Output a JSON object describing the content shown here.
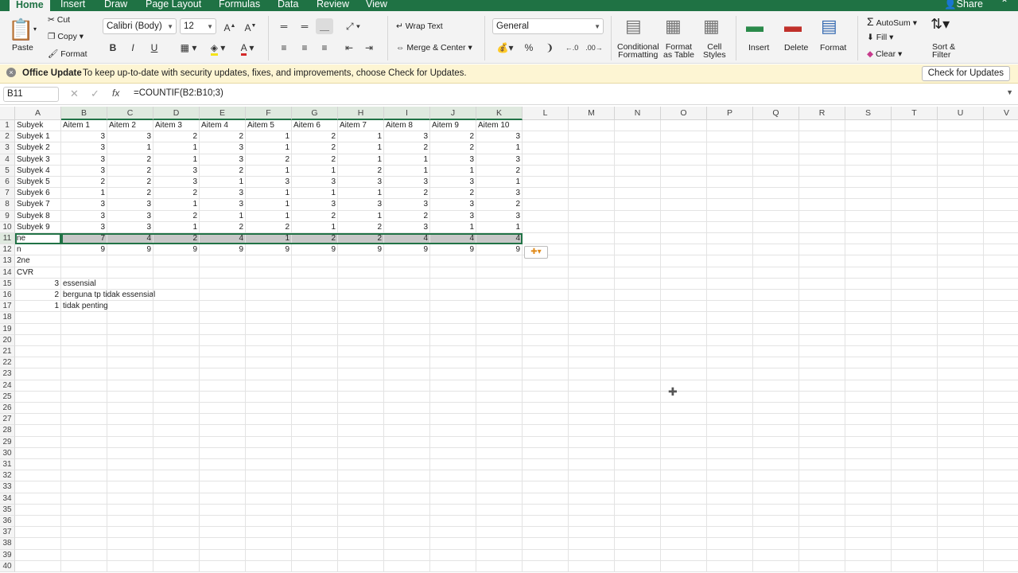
{
  "tabs": [
    "Home",
    "Insert",
    "Draw",
    "Page Layout",
    "Formulas",
    "Data",
    "Review",
    "View"
  ],
  "share": "Share",
  "ribbon": {
    "paste": "Paste",
    "cut": "Cut",
    "copy": "Copy",
    "format_painter": "Format",
    "font": "Calibri (Body)",
    "size": "12",
    "bold": "B",
    "italic": "I",
    "underline": "U",
    "wrap": "Wrap Text",
    "merge": "Merge & Center",
    "number_format": "General",
    "percent": "%",
    "cond1": "Conditional",
    "cond2": "Formatting",
    "fat1": "Format",
    "fat2": "as Table",
    "cs1": "Cell",
    "cs2": "Styles",
    "insert": "Insert",
    "delete": "Delete",
    "format": "Format",
    "autosum": "AutoSum",
    "fill": "Fill",
    "clear": "Clear",
    "sort1": "Sort &",
    "sort2": "Filter"
  },
  "notification": {
    "title": "Office Update",
    "text": "To keep up-to-date with security updates, fixes, and improvements, choose Check for Updates.",
    "button": "Check for Updates"
  },
  "formula_bar": {
    "cell_ref": "B11",
    "fx": "fx",
    "formula": "=COUNTIF(B2:B10;3)"
  },
  "columns": [
    "A",
    "B",
    "C",
    "D",
    "E",
    "F",
    "G",
    "H",
    "I",
    "J",
    "K",
    "L",
    "M",
    "N",
    "O",
    "P",
    "Q",
    "R",
    "S",
    "T",
    "U",
    "V"
  ],
  "row_count": 40,
  "cells": [
    [
      "Subyek",
      "Aitem 1",
      "Aitem 2",
      "Aitem 3",
      "Aitem 4",
      "Aitem 5",
      "Aitem 6",
      "Aitem 7",
      "Aitem 8",
      "Aitem 9",
      "Aitem 10"
    ],
    [
      "Subyek 1",
      "3",
      "3",
      "2",
      "2",
      "1",
      "2",
      "1",
      "3",
      "2",
      "3"
    ],
    [
      "Subyek 2",
      "3",
      "1",
      "1",
      "3",
      "1",
      "2",
      "1",
      "2",
      "2",
      "1"
    ],
    [
      "Subyek 3",
      "3",
      "2",
      "1",
      "3",
      "2",
      "2",
      "1",
      "1",
      "3",
      "3"
    ],
    [
      "Subyek 4",
      "3",
      "2",
      "3",
      "2",
      "1",
      "1",
      "2",
      "1",
      "1",
      "2"
    ],
    [
      "Subyek 5",
      "2",
      "2",
      "3",
      "1",
      "3",
      "3",
      "3",
      "3",
      "3",
      "1"
    ],
    [
      "Subyek 6",
      "1",
      "2",
      "2",
      "3",
      "1",
      "1",
      "1",
      "2",
      "2",
      "3"
    ],
    [
      "Subyek 7",
      "3",
      "3",
      "1",
      "3",
      "1",
      "3",
      "3",
      "3",
      "3",
      "2"
    ],
    [
      "Subyek 8",
      "3",
      "3",
      "2",
      "1",
      "1",
      "2",
      "1",
      "2",
      "3",
      "3"
    ],
    [
      "Subyek 9",
      "3",
      "3",
      "1",
      "2",
      "2",
      "1",
      "2",
      "3",
      "1",
      "1"
    ],
    [
      "ne",
      "7",
      "4",
      "2",
      "4",
      "1",
      "2",
      "2",
      "4",
      "4",
      "4"
    ],
    [
      "n",
      "9",
      "9",
      "9",
      "9",
      "9",
      "9",
      "9",
      "9",
      "9",
      "9"
    ],
    [
      "2ne"
    ],
    [
      "CVR"
    ],
    [
      "3",
      "essensial"
    ],
    [
      "2",
      "berguna tp tidak essensial"
    ],
    [
      "1",
      "tidak penting"
    ]
  ],
  "accent": "#1f7244"
}
